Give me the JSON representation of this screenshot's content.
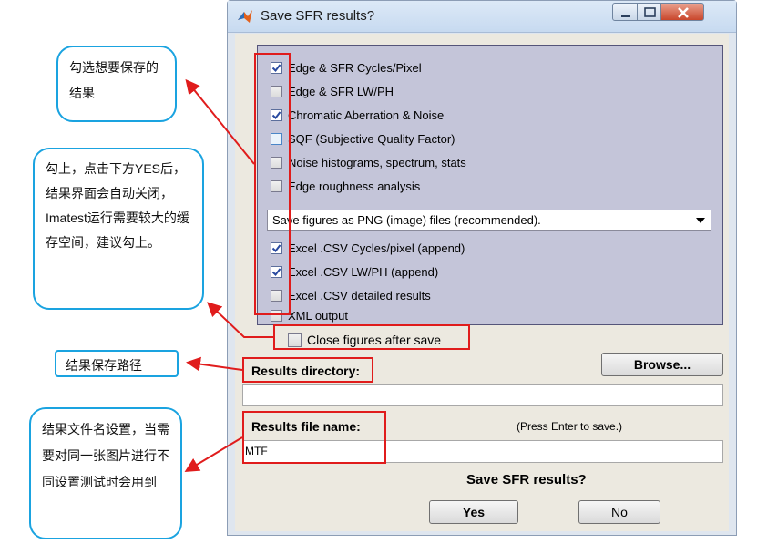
{
  "window": {
    "title": "Save SFR results?"
  },
  "checkboxes": [
    {
      "label": "Edge & SFR Cycles/Pixel",
      "checked": true
    },
    {
      "label": "Edge & SFR LW/PH",
      "checked": false
    },
    {
      "label": "Chromatic Aberration & Noise",
      "checked": true
    },
    {
      "label": "SQF (Subjective Quality Factor)",
      "checked": false
    },
    {
      "label": "Noise histograms, spectrum, stats",
      "checked": false
    },
    {
      "label": "Edge roughness analysis",
      "checked": false
    }
  ],
  "figure_format": {
    "selected": "Save figures as PNG (image) files (recommended)."
  },
  "csv_checkboxes": [
    {
      "label": "Excel .CSV Cycles/pixel (append)",
      "checked": true
    },
    {
      "label": "Excel .CSV LW/PH (append)",
      "checked": true
    },
    {
      "label": "Excel .CSV detailed results",
      "checked": false
    },
    {
      "label": "XML output",
      "checked": false
    }
  ],
  "close_figures": {
    "label": "Close figures after save",
    "checked": false
  },
  "results_directory": {
    "label": "Results directory:",
    "value": "",
    "browse_label": "Browse..."
  },
  "results_file_name": {
    "label": "Results file name:",
    "hint": "(Press Enter to save.)",
    "value": "MTF"
  },
  "confirm": {
    "question": "Save SFR results?",
    "yes_label": "Yes",
    "no_label": "No"
  },
  "callouts": {
    "select_results": "勾选想要保存的结果",
    "close_figures": "勾上，点击下方YES后，结果界面会自动关闭，Imatest运行需要较大的缓存空间，建议勾上。",
    "save_path": "结果保存路径",
    "file_name": "结果文件名设置，当需要对同一张图片进行不同设置测试时会用到"
  },
  "colors": {
    "annotation_red": "#e01c1c",
    "callout_border": "#1aa3e0",
    "panel_bg": "#c4c5d9"
  }
}
